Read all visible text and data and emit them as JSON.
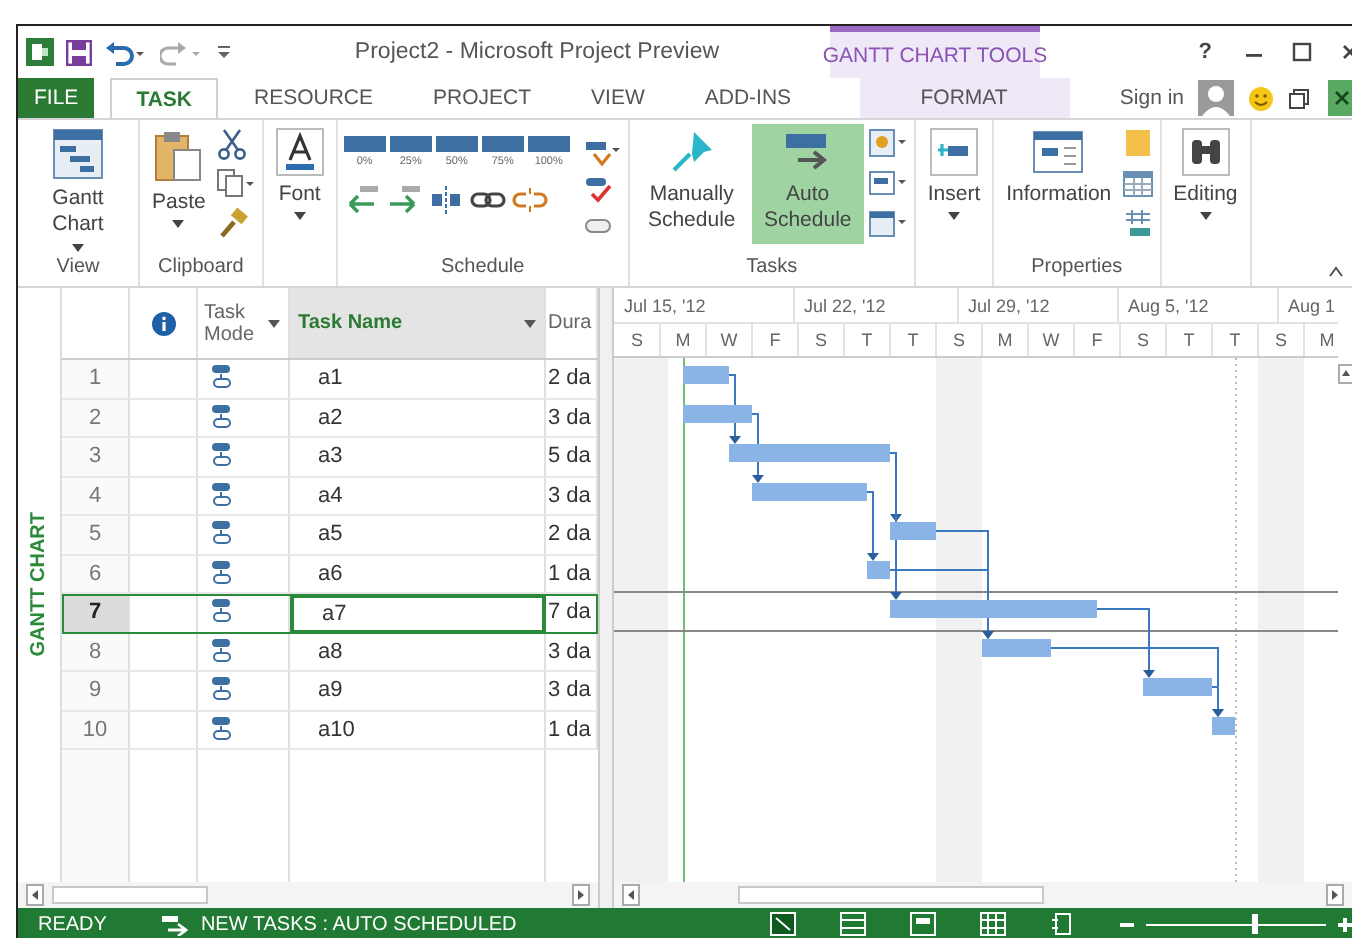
{
  "window": {
    "title": "Project2 - Microsoft Project Preview",
    "tool_group": "GANTT CHART TOOLS",
    "help": "?"
  },
  "tabs": [
    {
      "label": "FILE",
      "kind": "file",
      "selected": false
    },
    {
      "label": "TASK",
      "kind": "normal",
      "selected": true
    },
    {
      "label": "RESOURCE",
      "kind": "normal",
      "selected": false
    },
    {
      "label": "PROJECT",
      "kind": "normal",
      "selected": false
    },
    {
      "label": "VIEW",
      "kind": "normal",
      "selected": false
    },
    {
      "label": "ADD-INS",
      "kind": "normal",
      "selected": false
    },
    {
      "label": "FORMAT",
      "kind": "contextual",
      "selected": false
    }
  ],
  "account": {
    "sign_in": "Sign in"
  },
  "ribbon": {
    "view": {
      "label": "View",
      "button": "Gantt Chart"
    },
    "clipboard": {
      "label": "Clipboard",
      "paste": "Paste"
    },
    "font": {
      "button": "Font"
    },
    "schedule": {
      "label": "Schedule",
      "percents": [
        "0%",
        "25%",
        "50%",
        "75%",
        "100%"
      ]
    },
    "tasks": {
      "label": "Tasks",
      "buttons": [
        {
          "label": "Manually Schedule",
          "kind": "manual",
          "selected": false
        },
        {
          "label": "Auto Schedule",
          "kind": "auto",
          "selected": true
        }
      ]
    },
    "insert": {
      "button": "Insert"
    },
    "properties": {
      "label": "Properties",
      "button": "Information"
    },
    "editing": {
      "button": "Editing"
    }
  },
  "side_label": "GANTT CHART",
  "table": {
    "columns": [
      {
        "label": "Task Mode",
        "selected": false
      },
      {
        "label": "Task Name",
        "selected": true
      },
      {
        "label": "Dura",
        "selected": false
      }
    ],
    "rows": [
      {
        "id": "1",
        "name": "a1",
        "duration": "2 da",
        "selected": false
      },
      {
        "id": "2",
        "name": "a2",
        "duration": "3 da",
        "selected": false
      },
      {
        "id": "3",
        "name": "a3",
        "duration": "5 da",
        "selected": false
      },
      {
        "id": "4",
        "name": "a4",
        "duration": "3 da",
        "selected": false
      },
      {
        "id": "5",
        "name": "a5",
        "duration": "2 da",
        "selected": false
      },
      {
        "id": "6",
        "name": "a6",
        "duration": "1 da",
        "selected": false
      },
      {
        "id": "7",
        "name": "a7",
        "duration": "7 da",
        "selected": true
      },
      {
        "id": "8",
        "name": "a8",
        "duration": "3 da",
        "selected": false
      },
      {
        "id": "9",
        "name": "a9",
        "duration": "3 da",
        "selected": false
      },
      {
        "id": "10",
        "name": "a10",
        "duration": "1 da",
        "selected": false
      }
    ]
  },
  "timeline": {
    "weeks": [
      "Jul 15, '12",
      "Jul 22, '12",
      "Jul 29, '12",
      "Aug 5, '12",
      "Aug 1"
    ],
    "days": [
      "S",
      "M",
      "W",
      "F",
      "S",
      "T",
      "T",
      "S",
      "M",
      "W",
      "F",
      "S",
      "T",
      "T",
      "S",
      "M"
    ]
  },
  "status_bar": {
    "ready": "READY",
    "new_tasks": "NEW TASKS : AUTO SCHEDULED",
    "zoom": {
      "level": 0.6
    }
  }
}
